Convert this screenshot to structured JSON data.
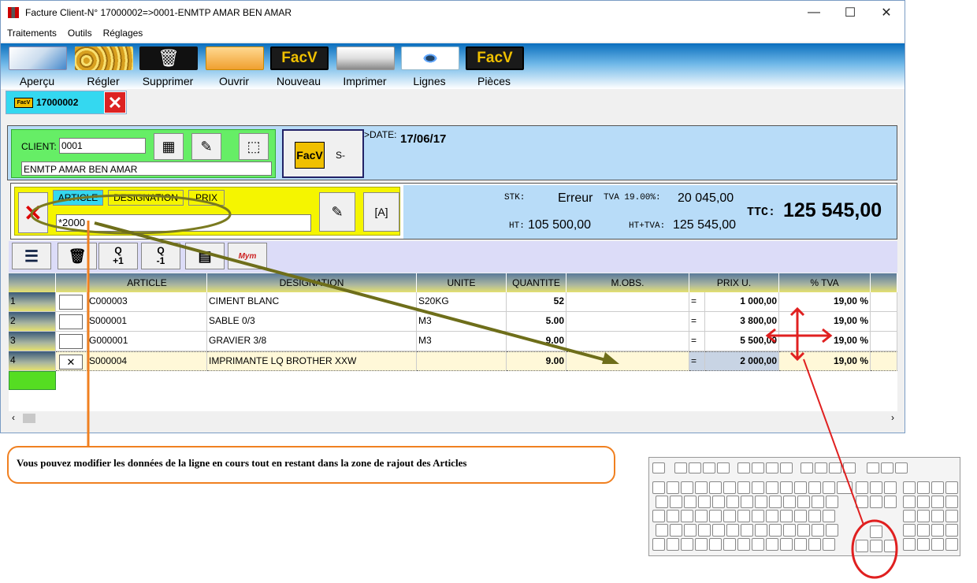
{
  "window": {
    "title": "Facture Client-N° 17000002=>0001-ENMTP AMAR BEN AMAR",
    "minimize": "—",
    "maximize": "☐",
    "close": "✕"
  },
  "menu": [
    "Traitements",
    "Outils",
    "Réglages"
  ],
  "toolbar": [
    {
      "label": "Aperçu",
      "icon": "preview-icon"
    },
    {
      "label": "Régler",
      "icon": "coins-icon"
    },
    {
      "label": "Supprimer",
      "icon": "trash-icon"
    },
    {
      "label": "Ouvrir",
      "icon": "folder-icon"
    },
    {
      "label": "Nouveau",
      "icon": "facv-icon",
      "badge": "FacV"
    },
    {
      "label": "Imprimer",
      "icon": "printer-icon"
    },
    {
      "label": "Lignes",
      "icon": "eye-icon"
    },
    {
      "label": "Pièces",
      "icon": "facv-icon",
      "badge": "FacV"
    }
  ],
  "doc_tab": {
    "badge": "FacV",
    "number": "17000002",
    "close": "✕"
  },
  "client": {
    "label": "CLIENT:",
    "code": "0001",
    "name": "ENMTP AMAR BEN AMAR"
  },
  "facv_box": {
    "badge": "FacV",
    "suffix": "S-"
  },
  "date": {
    "label": ">DATE:",
    "value": "17/06/17"
  },
  "article_entry": {
    "tabs": [
      "ARTICLE",
      "DESIGNATION",
      "PRIX"
    ],
    "input_value": "*2000",
    "cancel_icon": "✕"
  },
  "totals": {
    "stk_label": "STK:",
    "stk_value": "Erreur",
    "tva_label": "TVA 19.00%:",
    "tva_value": "20 045,00",
    "ht_label": "HT:",
    "ht_value": "105 500,00",
    "httva_label": "HT+TVA:",
    "httva_value": "125 545,00",
    "ttc_label": "TTC:",
    "ttc_value": "125 545,00"
  },
  "grid_toolbar": [
    {
      "icon": "menu-icon",
      "label": ""
    },
    {
      "icon": "trash-icon",
      "label": ""
    },
    {
      "icon": "qty-plus-icon",
      "label": "Q\n+1"
    },
    {
      "icon": "qty-minus-icon",
      "label": "Q\n-1"
    },
    {
      "icon": "notepad-icon",
      "label": ""
    },
    {
      "icon": "mym-icon",
      "label": "Mym"
    }
  ],
  "grid": {
    "columns": [
      "ARTICLE",
      "DESIGNATION",
      "UNITE",
      "QUANTITE",
      "M.OBS.",
      "PRIX U.",
      "% TVA"
    ],
    "rows": [
      {
        "n": "1",
        "article": "C000003",
        "designation": "CIMENT BLANC",
        "unite": "S20KG",
        "quantite": "52",
        "mobs": "",
        "eq": "=",
        "prix": "1 000,00",
        "tva": "19,00 %"
      },
      {
        "n": "2",
        "article": "S000001",
        "designation": "SABLE  0/3",
        "unite": "M3",
        "quantite": "5.00",
        "mobs": "",
        "eq": "=",
        "prix": "3 800,00",
        "tva": "19,00 %"
      },
      {
        "n": "3",
        "article": "G000001",
        "designation": "GRAVIER 3/8",
        "unite": "M3",
        "quantite": "9.00",
        "mobs": "",
        "eq": "=",
        "prix": "5 500,00",
        "tva": "19,00 %"
      },
      {
        "n": "4",
        "article": "S000004",
        "designation": "IMPRIMANTE LQ BROTHER XXW",
        "unite": "",
        "quantite": "9.00",
        "mobs": "",
        "eq": "=",
        "prix": "2 000,00",
        "tva": "19,00 %"
      }
    ]
  },
  "caption": "Vous pouvez modifier les données de la ligne en cours tout en restant dans la zone de rajout des Articles",
  "colors": {
    "toolbar_blue": "#0a6ebd",
    "client_green": "#66ee66",
    "article_yellow": "#f5f500",
    "panel_blue": "#b8dcf8",
    "annotation_olive": "#7a7a20",
    "annotation_orange": "#f08020",
    "annotation_red": "#e02020"
  }
}
